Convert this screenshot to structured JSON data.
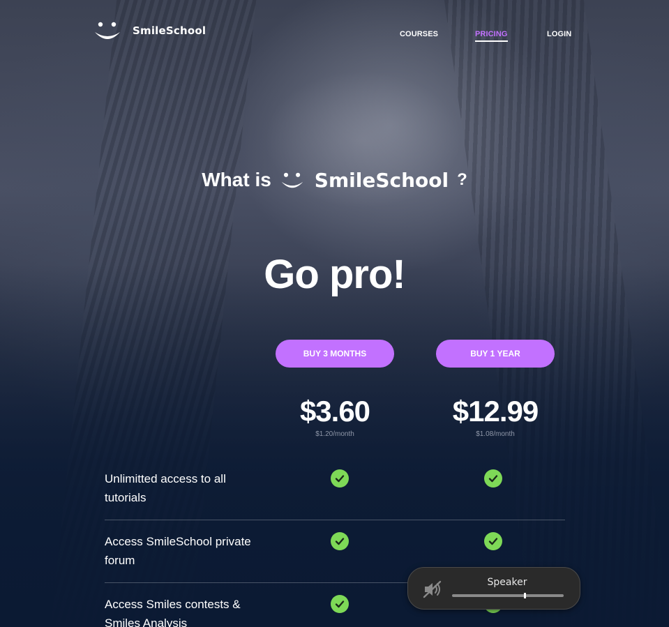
{
  "header": {
    "logo_text": "SmileSchool",
    "nav": [
      {
        "label": "COURSES",
        "active": false
      },
      {
        "label": "PRICING",
        "active": true
      },
      {
        "label": "LOGIN",
        "active": false
      }
    ]
  },
  "hero": {
    "what_is_prefix": "What is",
    "brand": "SmileSchool",
    "question_mark": "?",
    "headline": "Go pro!"
  },
  "plans": [
    {
      "button_label": "BUY 3 MONTHS",
      "price": "$3.60",
      "per_month": "$1.20/month"
    },
    {
      "button_label": "BUY 1 YEAR",
      "price": "$12.99",
      "per_month": "$1.08/month"
    }
  ],
  "features": [
    {
      "label": "Unlimitted access to all tutorials",
      "plan_3_months": true,
      "plan_1_year": true
    },
    {
      "label": "Access SmileSchool private forum",
      "plan_3_months": true,
      "plan_1_year": true
    },
    {
      "label": "Access Smiles contests & Smiles Analysis",
      "plan_3_months": true,
      "plan_1_year": true
    }
  ],
  "speaker_popup": {
    "label": "Speaker",
    "muted": true,
    "volume_fraction": 0.65
  },
  "colors": {
    "accent": "#c271ff",
    "check": "#7ed957",
    "background_dark": "#0b1a33"
  }
}
